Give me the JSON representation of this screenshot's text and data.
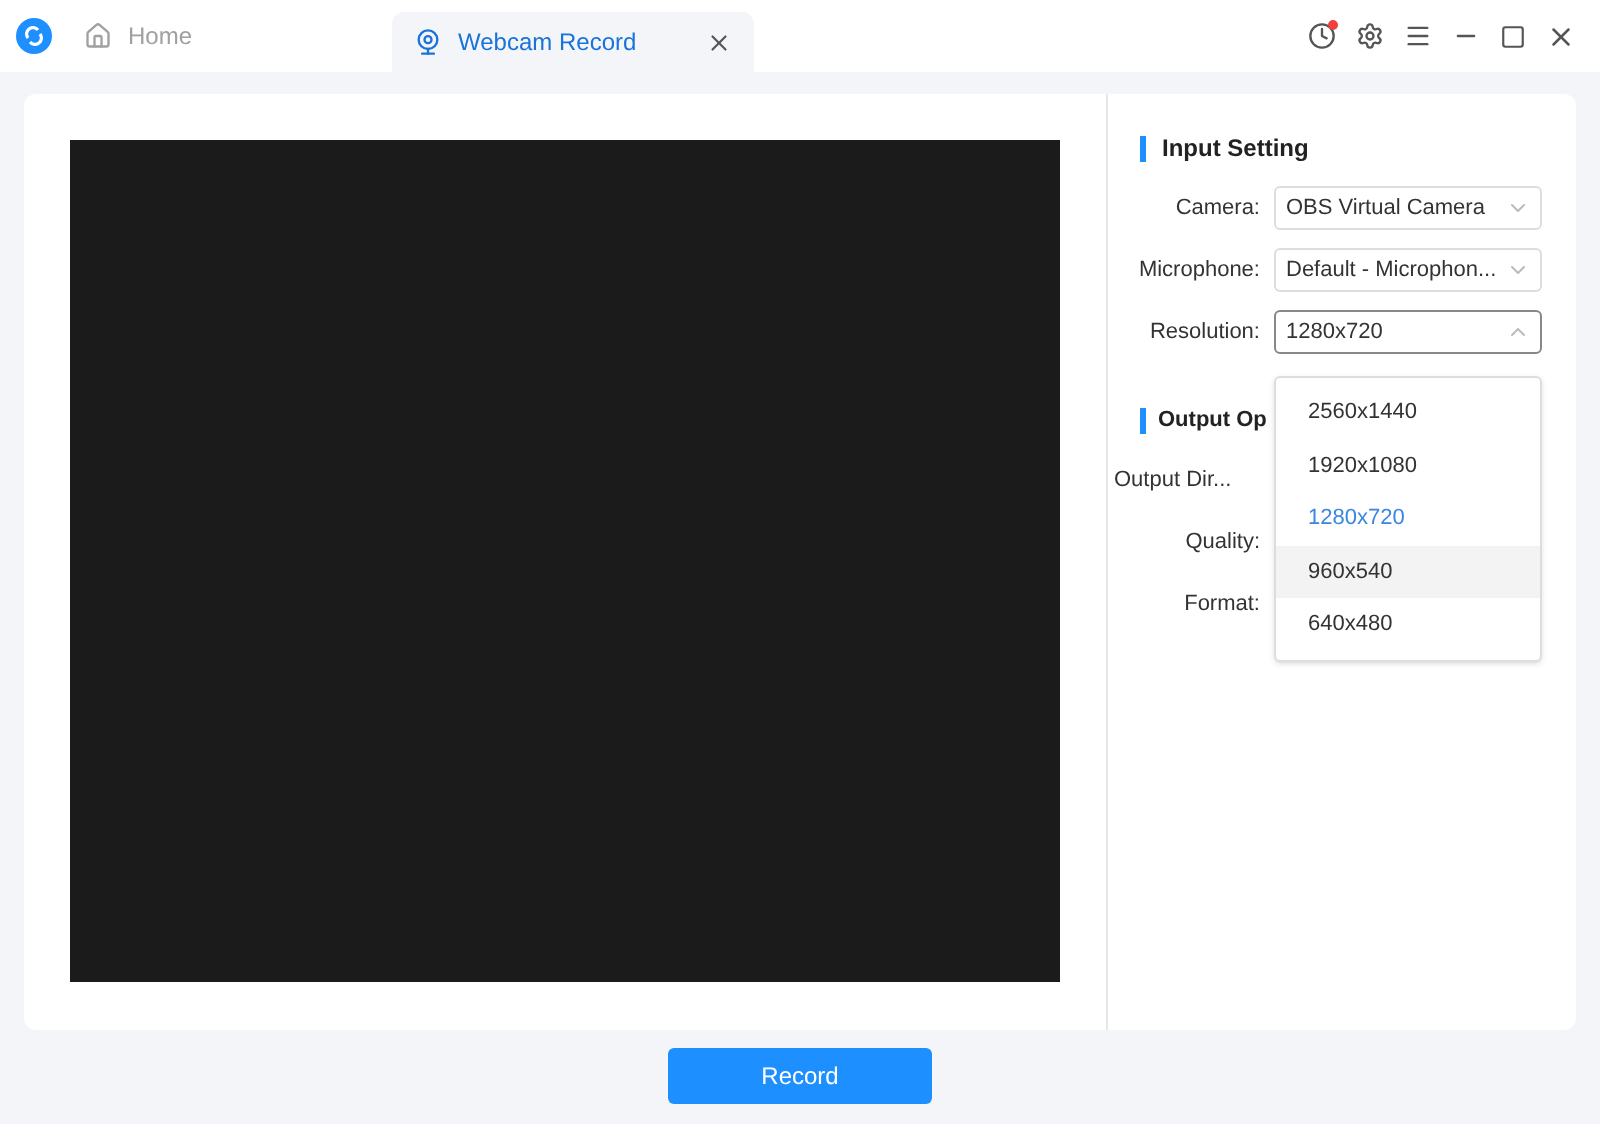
{
  "tabs": [
    {
      "label": "Home",
      "selected": false
    },
    {
      "label": "Webcam Record",
      "selected": true
    }
  ],
  "input_setting": {
    "title": "Input Setting",
    "fields": [
      {
        "label": "Camera:",
        "value": "OBS Virtual Camera",
        "expanded": false
      },
      {
        "label": "Microphone:",
        "value": "Default - Microphon...",
        "expanded": false
      },
      {
        "label": "Resolution:",
        "value": "1280x720",
        "expanded": true
      }
    ]
  },
  "resolution_options": [
    {
      "label": "2560x1440",
      "selected": false,
      "highlighted": false
    },
    {
      "label": "1920x1080",
      "selected": false,
      "highlighted": false
    },
    {
      "label": "1280x720",
      "selected": true,
      "highlighted": false
    },
    {
      "label": "960x540",
      "selected": false,
      "highlighted": true
    },
    {
      "label": "640x480",
      "selected": false,
      "highlighted": false
    }
  ],
  "output_options": {
    "title": "Output Op",
    "labels": [
      "Output Dir...",
      "Quality:",
      "Format:"
    ]
  },
  "record_button": "Record"
}
